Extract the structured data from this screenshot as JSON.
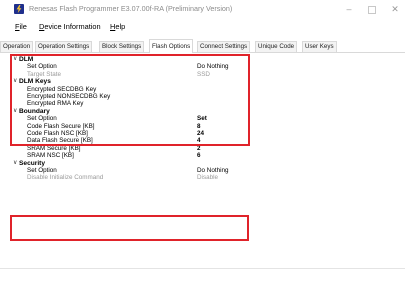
{
  "window": {
    "title": "Renesas Flash Programmer E3.07.00f-RA  (Preliminary Version)",
    "minimize_glyph": "–",
    "close_glyph": "✕",
    "app_icon": "renesas-flash-programmer-icon"
  },
  "menu": {
    "file": {
      "mnemonic": "F",
      "rest": "ile"
    },
    "device_information": {
      "mnemonic": "D",
      "rest": "evice Information"
    },
    "help": {
      "mnemonic": "H",
      "rest": "elp"
    }
  },
  "tabs": [
    {
      "label": "Operation"
    },
    {
      "label": "Operation Settings"
    },
    {
      "label": "Block Settings"
    },
    {
      "label": "Flash Options",
      "active": true
    },
    {
      "label": "Connect Settings"
    },
    {
      "label": "Unique Code"
    },
    {
      "label": "User Keys"
    }
  ],
  "grid": {
    "dlm": {
      "header": "DLM",
      "set_option": {
        "name": "Set Option",
        "value": "Do Nothing"
      },
      "target_state": {
        "name": "Target State",
        "value": "SSD"
      }
    },
    "dlm_keys": {
      "header": "DLM Keys",
      "secdbg": {
        "name": "Encrypted SECDBG Key"
      },
      "nonsecdbg": {
        "name": "Encrypted NONSECDBG Key"
      },
      "rma": {
        "name": "Encrypted RMA Key"
      }
    },
    "boundary": {
      "header": "Boundary",
      "set_option": {
        "name": "Set Option",
        "value": "Set"
      },
      "code_flash_secure": {
        "name": "Code Flash Secure [KB]",
        "value": "8"
      },
      "code_flash_nsc": {
        "name": "Code Flash NSC [KB]",
        "value": "24"
      },
      "data_flash_secure": {
        "name": "Data Flash Secure [KB]",
        "value": "4"
      },
      "sram_secure": {
        "name": "SRAM Secure [KB]",
        "value": "2"
      },
      "sram_nsc": {
        "name": "SRAM NSC [KB]",
        "value": "6"
      }
    },
    "security": {
      "header": "Security",
      "set_option": {
        "name": "Set Option",
        "value": "Do Nothing"
      },
      "disable_init": {
        "name": "Disable Initialize Command",
        "value": "Disable"
      }
    },
    "collapse_glyph": "∨"
  },
  "colors": {
    "highlight": "#e0232a",
    "disabled_text": "#9a9a9a"
  }
}
